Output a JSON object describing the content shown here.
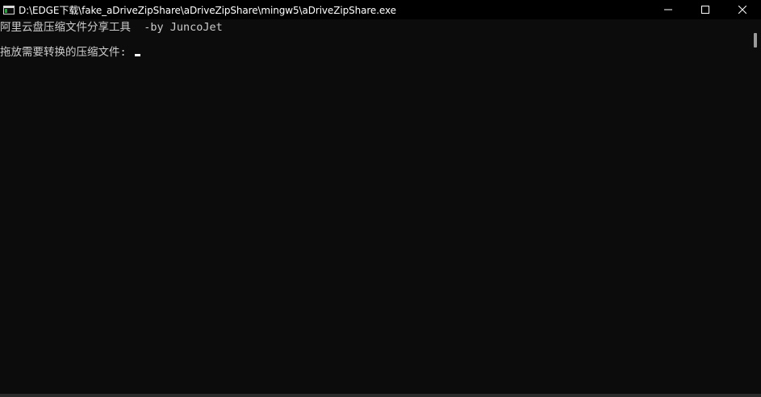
{
  "window": {
    "title": "D:\\EDGE下载\\fake_aDriveZipShare\\aDriveZipShare\\mingw5\\aDriveZipShare.exe",
    "icon": "console-app-icon"
  },
  "caption_buttons": {
    "minimize": "minimize-icon",
    "maximize": "maximize-icon",
    "close": "close-icon"
  },
  "console": {
    "lines": [
      "阿里云盘压缩文件分享工具  -by JuncoJet",
      "拖放需要转换的压缩文件: "
    ],
    "colors": {
      "background": "#0c0c0c",
      "foreground": "#cccccc"
    }
  }
}
